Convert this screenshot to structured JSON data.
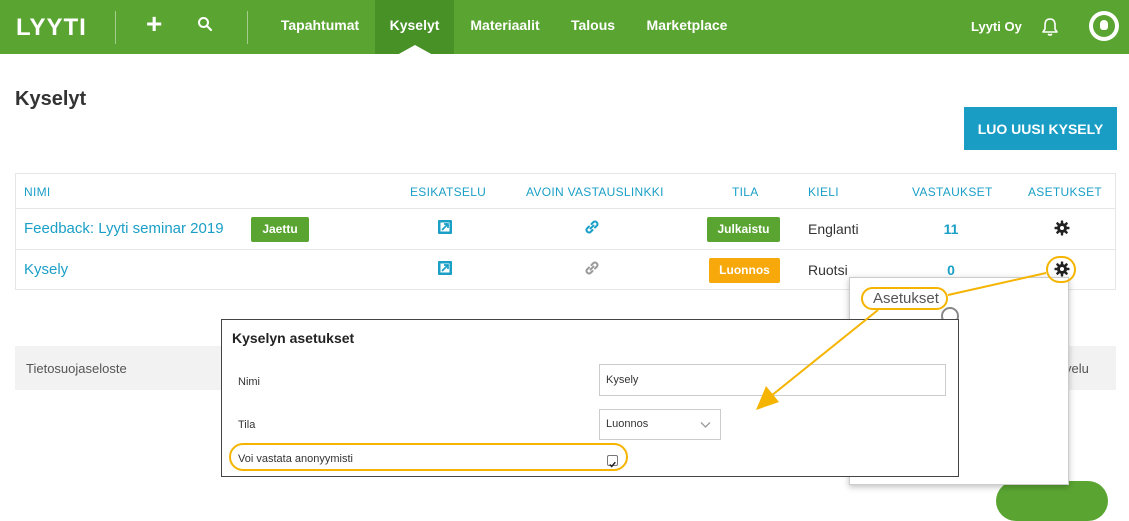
{
  "nav": {
    "logo": "LYYTI",
    "items": [
      "Tapahtumat",
      "Kyselyt",
      "Materiaalit",
      "Talous",
      "Marketplace"
    ],
    "active_index": 1,
    "org": "Lyyti Oy"
  },
  "page": {
    "title": "Kyselyt",
    "create_button": "LUO UUSI KYSELY"
  },
  "table": {
    "headers": {
      "name": "NIMI",
      "preview": "ESIKATSELU",
      "open_link": "AVOIN VASTAUSLINKKI",
      "status": "TILA",
      "language": "KIELI",
      "answers": "VASTAUKSET",
      "settings": "ASETUKSET"
    },
    "rows": [
      {
        "name": "Feedback: Lyyti seminar 2019",
        "tag": "Jaettu",
        "status": "Julkaistu",
        "status_color": "#5aa532",
        "language": "Englanti",
        "answers": "11"
      },
      {
        "name": "Kysely",
        "tag": "",
        "status": "Luonnos",
        "status_color": "#f7a80a",
        "language": "Ruotsi",
        "answers": "0"
      }
    ]
  },
  "footer": {
    "left": "Tietosuojaseloste",
    "right": "velu"
  },
  "popover": {
    "label": "Asetukset"
  },
  "modal": {
    "title": "Kyselyn asetukset",
    "name_label": "Nimi",
    "name_value": "Kysely",
    "status_label": "Tila",
    "status_value": "Luonnos",
    "anon_label": "Voi vastata anonyymisti",
    "anon_checked": true
  },
  "colors": {
    "brand_green": "#5aa532",
    "accent_blue": "#1a9fc6",
    "draft_orange": "#f7a80a",
    "highlight": "#f5b400"
  }
}
